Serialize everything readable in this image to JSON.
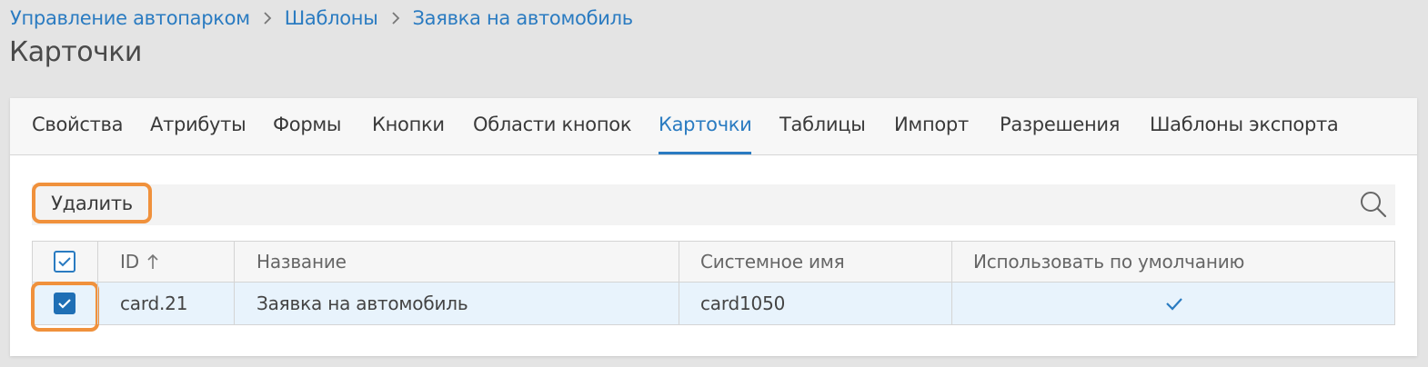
{
  "breadcrumb": {
    "items": [
      "Управление автопарком",
      "Шаблоны",
      "Заявка на автомобиль"
    ]
  },
  "page_title": "Карточки",
  "tabs": [
    {
      "label": "Свойства",
      "active": false
    },
    {
      "label": "Атрибуты",
      "active": false
    },
    {
      "label": "Формы",
      "active": false
    },
    {
      "label": "Кнопки",
      "active": false
    },
    {
      "label": "Области кнопок",
      "active": false
    },
    {
      "label": "Карточки",
      "active": true
    },
    {
      "label": "Таблицы",
      "active": false
    },
    {
      "label": "Импорт",
      "active": false
    },
    {
      "label": "Разрешения",
      "active": false
    },
    {
      "label": "Шаблоны экспорта",
      "active": false
    }
  ],
  "toolbar": {
    "delete_label": "Удалить",
    "search_icon": "search-icon"
  },
  "table": {
    "columns": [
      "ID",
      "Название",
      "Системное имя",
      "Использовать по умолчанию"
    ],
    "sort_column": "ID",
    "sort_direction": "ascending",
    "header_checkbox_checked": false,
    "rows": [
      {
        "selected": true,
        "id": "card.21",
        "name": "Заявка на автомобиль",
        "system_name": "card1050",
        "use_default": true
      }
    ]
  },
  "colors": {
    "accent": "#2a7bc1",
    "highlight": "#f0913c",
    "selected_row": "#e8f3fc"
  }
}
